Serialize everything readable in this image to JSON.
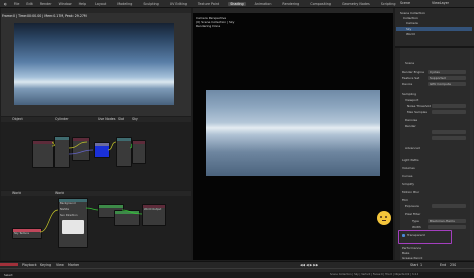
{
  "topbar": {
    "menus": [
      "File",
      "Edit",
      "Render",
      "Window",
      "Help"
    ],
    "tabs": [
      "Layout",
      "Modeling",
      "Sculpting",
      "UV Editing",
      "Texture Paint",
      "Shading",
      "Animation",
      "Rendering",
      "Compositing",
      "Geometry Nodes",
      "Scripting"
    ],
    "active_tab": "Shading",
    "scene_label": "Scene",
    "view_layer_label": "ViewLayer"
  },
  "left_viewport": {
    "info": "Frame:0 | Time:00:00.00 | Mem:0.17M, Peak: 29.27M"
  },
  "render_view": {
    "info_lines": [
      "Camera Perspective",
      "(0) Scene Collection | Sky",
      "Rendering Done"
    ]
  },
  "outliner": {
    "rows": [
      "Scene Collection",
      "Collection",
      "Camera",
      "Sky",
      "World"
    ]
  },
  "properties": {
    "section": "Scene",
    "render_engine_label": "Render Engine",
    "render_engine": "Cycles",
    "feature_set_label": "Feature Set",
    "feature_set": "Supported",
    "device_label": "Device",
    "device": "GPU Compute",
    "sampling": "Sampling",
    "viewport": "Viewport",
    "noise_threshold": "Noise Threshold",
    "max_samples": "Max Samples",
    "denoise": "Denoise",
    "render": "Render",
    "advanced": "Advanced",
    "light_paths": "Light Paths",
    "volumes": "Volumes",
    "curves": "Curves",
    "simplify": "Simplify",
    "motion_blur": "Motion Blur",
    "film": "Film",
    "exposure": "Exposure",
    "pixel_filter": "Pixel Filter",
    "type_label": "Type",
    "type_value": "Blackman-Harris",
    "width_label": "Width",
    "transparent": "Transparent",
    "performance": "Performance",
    "bake": "Bake",
    "grease_pencil": "Grease Pencil",
    "freestyle": "Freestyle",
    "color_management": "Color Management"
  },
  "node_editor_1": {
    "object_label": "Object",
    "name": "Cylinder",
    "use_nodes": "Use Nodes",
    "slot": "Slot",
    "material": "Sky"
  },
  "node_editor_2": {
    "world_label": "World",
    "name": "World",
    "nodes": [
      "Sky Texture",
      "Background",
      "World Output",
      "Nishita"
    ],
    "sun_direction": "Sun Direction"
  },
  "timeline": {
    "playback": "Playback",
    "keying": "Keying",
    "view": "View",
    "marker": "Marker",
    "start_label": "Start",
    "start": "1",
    "end_label": "End",
    "end": "250"
  },
  "status": {
    "left": "Select",
    "right": "Scene Collection | Sky | Verts:0 | Faces:0 | Tris:0 | Objects:0/2 | 3.4.1"
  },
  "colors": {
    "highlight": "#a43fbf",
    "selection": "#34537a"
  }
}
